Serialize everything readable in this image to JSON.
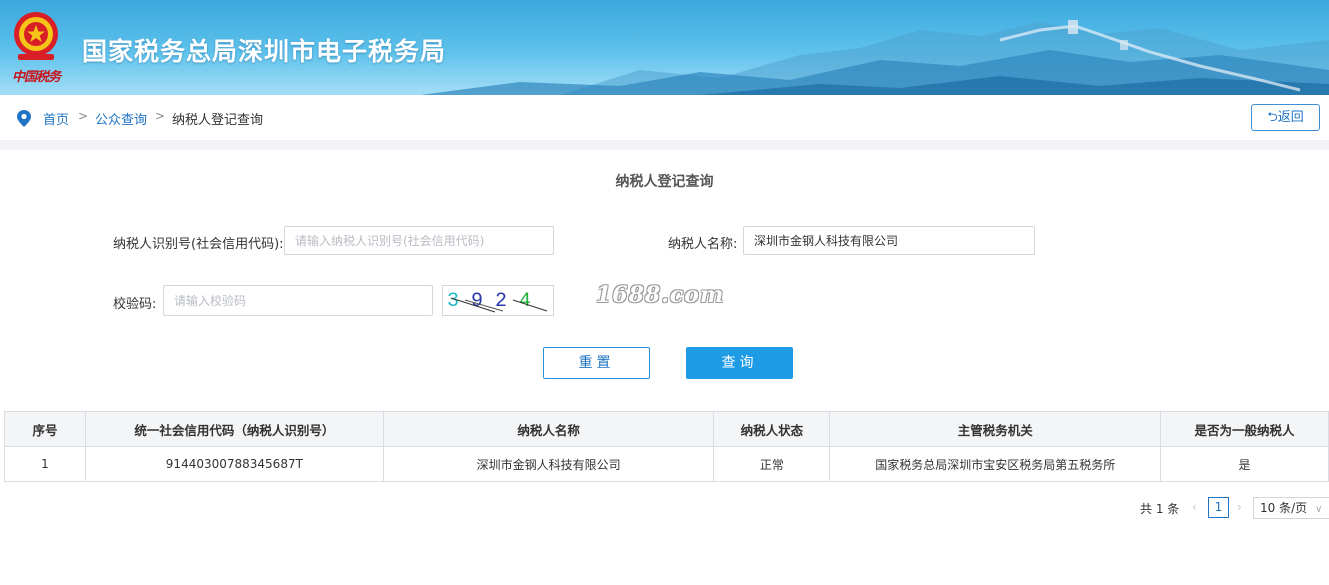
{
  "header": {
    "title": "国家税务总局深圳市电子税务局",
    "emblem_caption": "中国税务",
    "brand_color": "#3aa8de"
  },
  "breadcrumb": {
    "items": [
      "首页",
      "公众查询",
      "纳税人登记查询"
    ],
    "separator": ">"
  },
  "back_button": {
    "label": "⮌返回"
  },
  "form": {
    "title": "纳税人登记查询",
    "taxpayer_id_label": "纳税人识别号(社会信用代码):",
    "taxpayer_id_value": "",
    "taxpayer_id_placeholder": "请输入纳税人识别号(社会信用代码)",
    "taxpayer_name_label": "纳税人名称:",
    "taxpayer_name_value": "深圳市金钢人科技有限公司",
    "captcha_label": "校验码:",
    "captcha_placeholder": "请输入校验码",
    "captcha_text": "3924",
    "reset_label": "重置",
    "query_label": "查询",
    "watermark": "1688.com"
  },
  "table": {
    "columns": [
      "序号",
      "统一社会信用代码（纳税人识别号）",
      "纳税人名称",
      "纳税人状态",
      "主管税务机关",
      "是否为一般纳税人"
    ],
    "rows": [
      [
        "1",
        "91440300788345687T",
        "深圳市金钢人科技有限公司",
        "正常",
        "国家税务总局深圳市宝安区税务局第五税务所",
        "是"
      ]
    ]
  },
  "pagination": {
    "total_text": "共 1 条",
    "prev_icon": "‹",
    "next_icon": "›",
    "current_page": "1",
    "page_size_text": "10 条/页",
    "page_size_icon": "∨"
  }
}
